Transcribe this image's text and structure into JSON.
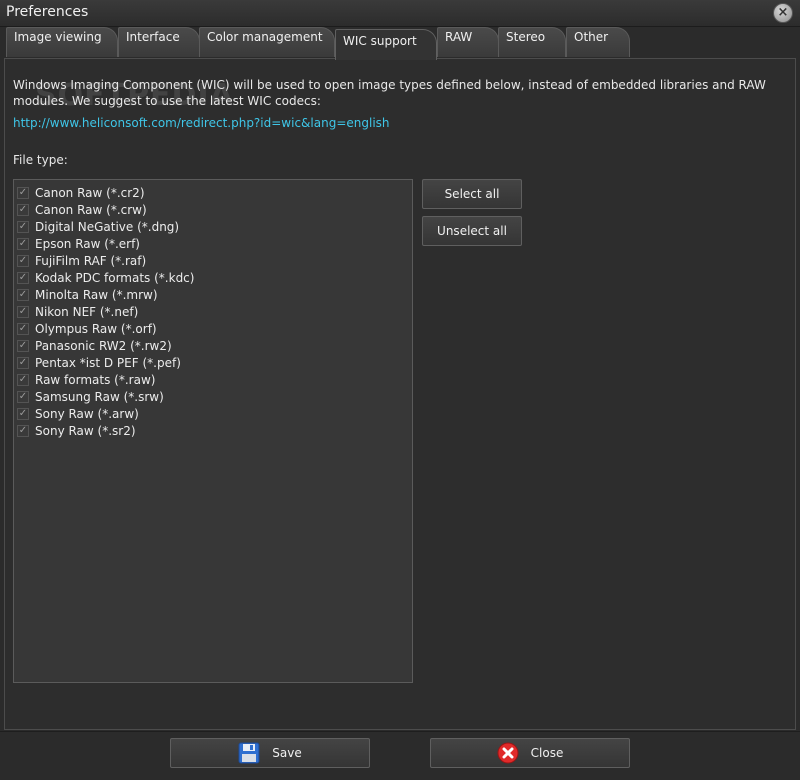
{
  "window": {
    "title": "Preferences"
  },
  "tabs": [
    {
      "label": "Image viewing"
    },
    {
      "label": "Interface"
    },
    {
      "label": "Color management"
    },
    {
      "label": "WIC support"
    },
    {
      "label": "RAW"
    },
    {
      "label": "Stereo"
    },
    {
      "label": "Other"
    }
  ],
  "active_tab": "WIC support",
  "content": {
    "description": "Windows Imaging Component (WIC) will be used to open image types defined below, instead of embedded libraries and RAW modules. We suggest to use the latest WIC codecs:",
    "link": "http://www.heliconsoft.com/redirect.php?id=wic&lang=english",
    "file_type_label": "File type:",
    "watermark": "SOFTPEDIA"
  },
  "file_types": [
    {
      "label": "Canon Raw (*.cr2)",
      "checked": true
    },
    {
      "label": "Canon Raw (*.crw)",
      "checked": true
    },
    {
      "label": "Digital NeGative (*.dng)",
      "checked": true
    },
    {
      "label": "Epson Raw (*.erf)",
      "checked": true
    },
    {
      "label": "FujiFilm RAF (*.raf)",
      "checked": true
    },
    {
      "label": "Kodak PDC formats (*.kdc)",
      "checked": true
    },
    {
      "label": "Minolta Raw (*.mrw)",
      "checked": true
    },
    {
      "label": "Nikon NEF (*.nef)",
      "checked": true
    },
    {
      "label": "Olympus Raw (*.orf)",
      "checked": true
    },
    {
      "label": "Panasonic RW2 (*.rw2)",
      "checked": true
    },
    {
      "label": "Pentax *ist D PEF (*.pef)",
      "checked": true
    },
    {
      "label": "Raw formats (*.raw)",
      "checked": true
    },
    {
      "label": "Samsung Raw (*.srw)",
      "checked": true
    },
    {
      "label": "Sony Raw (*.arw)",
      "checked": true
    },
    {
      "label": "Sony Raw (*.sr2)",
      "checked": true
    }
  ],
  "buttons": {
    "select_all": "Select all",
    "unselect_all": "Unselect all",
    "save": "Save",
    "close": "Close"
  },
  "icons": {
    "save": "floppy-disk-icon",
    "close": "red-x-circle-icon",
    "window_close": "close-icon"
  },
  "colors": {
    "background": "#2b2b2b",
    "link": "#3fc6e8",
    "close_icon": "#e02a2a",
    "save_icon": "#2f6fd0"
  }
}
